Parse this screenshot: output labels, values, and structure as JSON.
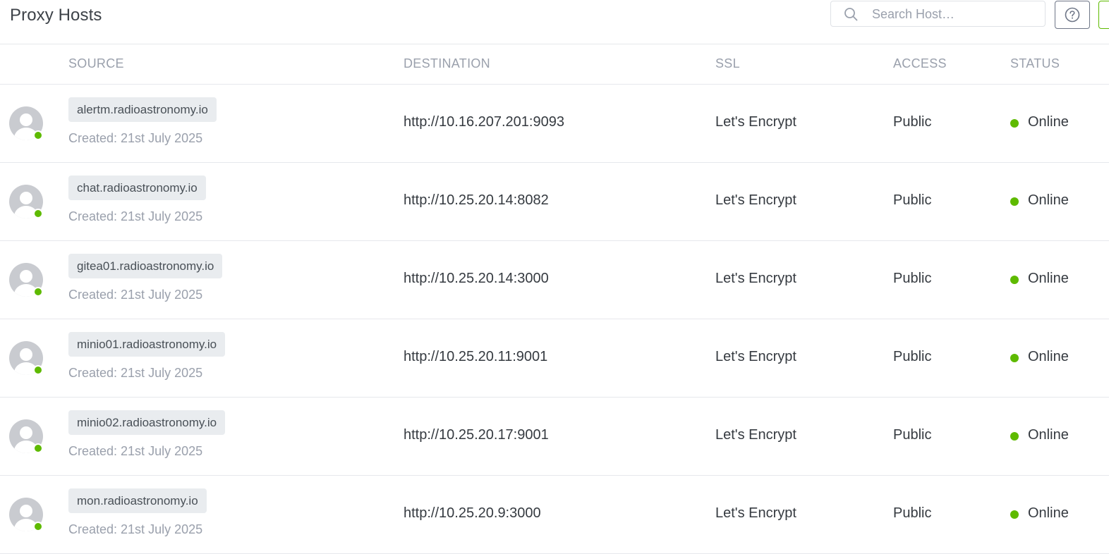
{
  "header": {
    "title": "Proxy Hosts",
    "search_placeholder": "Search Host…",
    "search_icon": "search-icon",
    "help_icon": "help-circle-icon"
  },
  "columns": {
    "source": "SOURCE",
    "destination": "DESTINATION",
    "ssl": "SSL",
    "access": "ACCESS",
    "status": "STATUS"
  },
  "rows": [
    {
      "host": "alertm.radioastronomy.io",
      "created": "Created: 21st July 2025",
      "destination": "http://10.16.207.201:9093",
      "ssl": "Let's Encrypt",
      "access": "Public",
      "status": "Online"
    },
    {
      "host": "chat.radioastronomy.io",
      "created": "Created: 21st July 2025",
      "destination": "http://10.25.20.14:8082",
      "ssl": "Let's Encrypt",
      "access": "Public",
      "status": "Online"
    },
    {
      "host": "gitea01.radioastronomy.io",
      "created": "Created: 21st July 2025",
      "destination": "http://10.25.20.14:3000",
      "ssl": "Let's Encrypt",
      "access": "Public",
      "status": "Online"
    },
    {
      "host": "minio01.radioastronomy.io",
      "created": "Created: 21st July 2025",
      "destination": "http://10.25.20.11:9001",
      "ssl": "Let's Encrypt",
      "access": "Public",
      "status": "Online"
    },
    {
      "host": "minio02.radioastronomy.io",
      "created": "Created: 21st July 2025",
      "destination": "http://10.25.20.17:9001",
      "ssl": "Let's Encrypt",
      "access": "Public",
      "status": "Online"
    },
    {
      "host": "mon.radioastronomy.io",
      "created": "Created: 21st July 2025",
      "destination": "http://10.25.20.9:3000",
      "ssl": "Let's Encrypt",
      "access": "Public",
      "status": "Online"
    }
  ],
  "colors": {
    "online": "#5eba00",
    "tag_bg": "#e9ecef",
    "muted_text": "#9aa0ac"
  }
}
